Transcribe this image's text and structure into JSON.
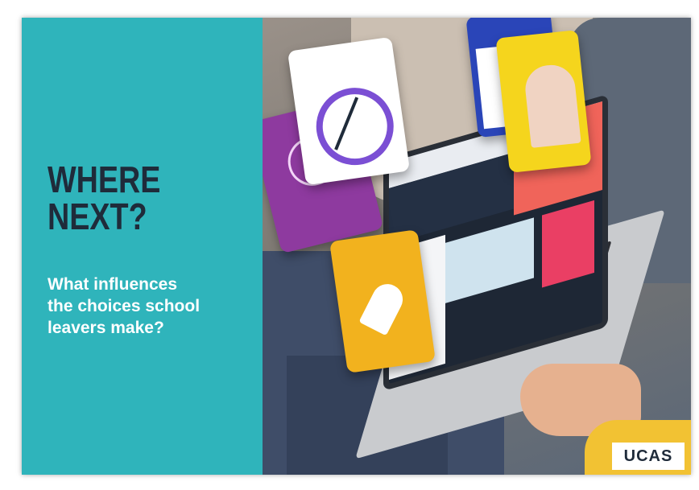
{
  "headline": {
    "line1": "WHERE",
    "line2": "NEXT?"
  },
  "subhead": {
    "line1": "What influences",
    "line2": "the choices school",
    "line3": "leavers make?"
  },
  "logo": "UCAS",
  "colors": {
    "panel": "#2fb4bb",
    "headline": "#1f2b3a",
    "subhead": "#ffffff"
  }
}
